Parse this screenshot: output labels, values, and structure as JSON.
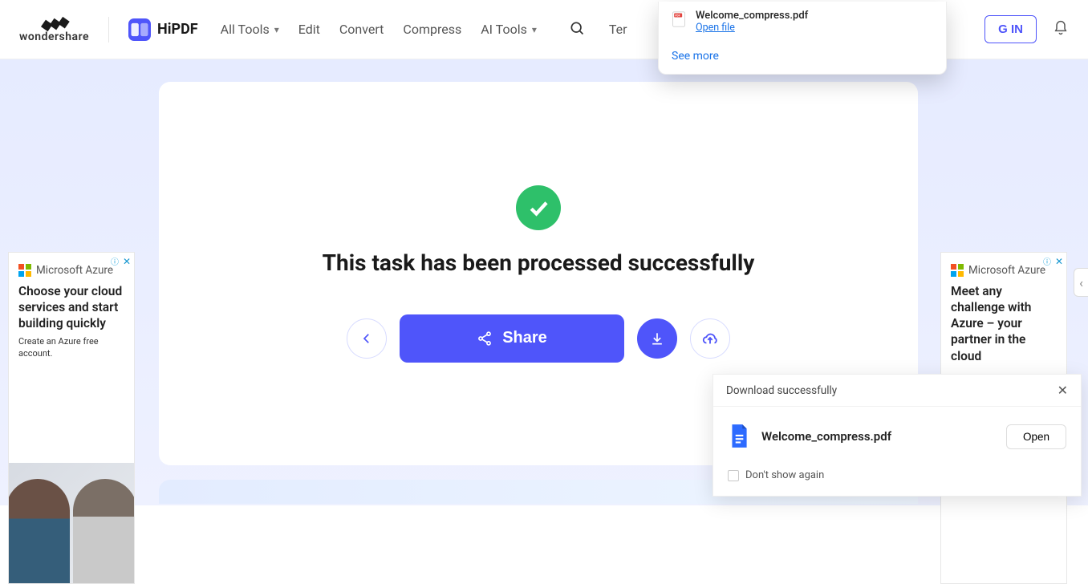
{
  "header": {
    "brand": "wondershare",
    "product": "HiPDF",
    "nav": {
      "all_tools": "All Tools",
      "edit": "Edit",
      "convert": "Convert",
      "compress": "Compress",
      "ai_tools": "AI Tools",
      "templates_partial": "Ter"
    },
    "login_partial": "G IN"
  },
  "download_dropdown": {
    "filename": "Welcome_compress.pdf",
    "open_label": "Open file",
    "see_more": "See more"
  },
  "main": {
    "success_title": "This task has been processed successfully",
    "share_label": "Share"
  },
  "ads": {
    "brand": "Microsoft Azure",
    "left_headline": "Choose your cloud services and start building quickly",
    "left_sub": "Create an Azure free account.",
    "right_headline": "Meet any challenge with Azure – your partner in the cloud"
  },
  "toast": {
    "title": "Download successfully",
    "filename": "Welcome_compress.pdf",
    "open": "Open",
    "dont_show": "Don't show again"
  }
}
